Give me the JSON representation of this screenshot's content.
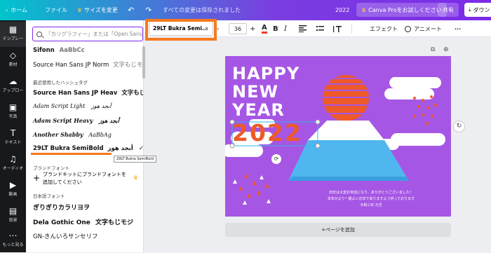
{
  "topbar": {
    "home": "ホーム",
    "file": "ファイル",
    "resize": "サイズを変更",
    "saved": "すべての変更は保存されました",
    "year": "2022",
    "canva_pro": "Canva Proをお試しください",
    "share": "共有",
    "download": "ダウン",
    "check_icon": "✓",
    "crown_icon": "♛",
    "undo_icon": "↶",
    "redo_icon": "↷",
    "cloud_icon": "☁",
    "download_icon": "⤓"
  },
  "rail": [
    {
      "label": "テンプレー",
      "icon": "▦"
    },
    {
      "label": "素材",
      "icon": "◇"
    },
    {
      "label": "アップロー",
      "icon": "☁"
    },
    {
      "label": "写真",
      "icon": "▣"
    },
    {
      "label": "テキスト",
      "icon": "T"
    },
    {
      "label": "オーディオ",
      "icon": "♫"
    },
    {
      "label": "動画",
      "icon": "▶"
    },
    {
      "label": "背景",
      "icon": "▤"
    },
    {
      "label": "もっと見る",
      "icon": "⋯"
    }
  ],
  "panel": {
    "search_placeholder": "「カリグラフィー」または「Open Sans",
    "fonts_top": [
      {
        "name": "Sifonn",
        "sample": "AaBbCc"
      },
      {
        "name": "Source Han Sans JP Norm",
        "sample": "文字もじモジ"
      }
    ],
    "section_recent": "最近使用したハッシュタグ",
    "fonts_recent": [
      {
        "name": "Source Han Sans JP Heav",
        "sample": "文字もじモジ"
      },
      {
        "name": "Adam Script Light",
        "sample": "أبجد هوز"
      },
      {
        "name": "Adam Script Heavy",
        "sample": "أبجد هوز"
      },
      {
        "name": "Another Shabby",
        "sample": "AaBbAg"
      },
      {
        "name": "29LT Bukra SemiBold",
        "sample": "أبجد هوز"
      }
    ],
    "selected_check": "✓",
    "tooltip": "29LT Bukra SemiBold",
    "section_brand": "ブランドフォント",
    "brand_line1": "ブランドキットにブランドフォントを",
    "brand_line2": "追加してください",
    "brand_plus": "+",
    "brand_crown": "♛",
    "section_jp": "日本語フォント",
    "fonts_jp": [
      {
        "name": "ぎりぎりカラリヨヲ",
        "sample": ""
      },
      {
        "name": "Dela Gothic One",
        "sample": "文字もじモジ"
      },
      {
        "name": "GN-きんいろサンセリフ",
        "sample": ""
      }
    ]
  },
  "toolbar": {
    "font_select": "29LT Bukra Semi...",
    "size": "36",
    "minus": "-",
    "plus": "+",
    "color_label": "A",
    "bold": "B",
    "italic": "I",
    "effects": "エフェクト",
    "animate": "アニメート",
    "more": "···"
  },
  "canvas": {
    "happy": "HAPPY",
    "new": "NEW",
    "year_word": "YEAR",
    "year_num": "2022",
    "message_lines": [
      "旧年は大変お世話になり、ありがとうございました！",
      "本年がより一層よいお年でありますよう祈っております",
      "令和三年 元旦"
    ],
    "add_page": "+ページを追加",
    "rotate_icon": "⟳",
    "copy_icon": "⧉",
    "plus_icon": "⊕",
    "refresh_icon": "↻",
    "colors": {
      "page": "#a656e4",
      "sun": "#ee5a2a",
      "mountain_top": "#ffffff",
      "mountain_base": "#4fb6ef",
      "year_text": "#ee5a2a",
      "highlight": "#f47a20"
    }
  }
}
